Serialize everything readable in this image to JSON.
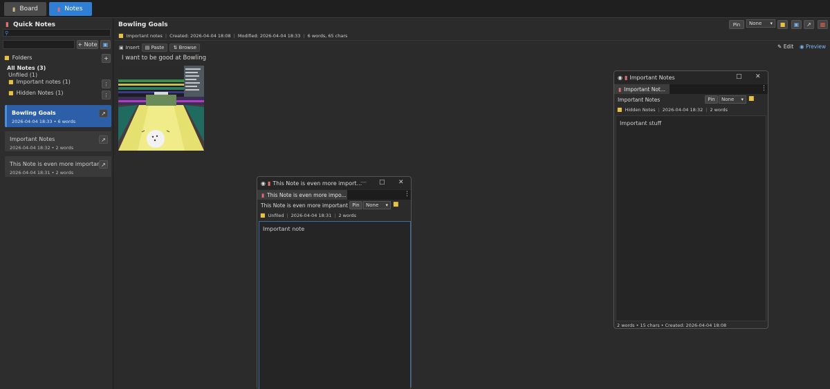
{
  "top_tabs": [
    {
      "label": "Board",
      "icon": "board-icon"
    },
    {
      "label": "Notes",
      "icon": "note-icon",
      "active": true
    }
  ],
  "sidebar": {
    "title": "Quick Notes",
    "search_placeholder": "",
    "new_note_label": "+ Note",
    "folders_label": "Folders",
    "folder_add_label": "+",
    "tree": {
      "all_notes": "All Notes (3)",
      "unfiled": "Unfiled (1)",
      "folders": [
        {
          "label": "Important notes (1)"
        },
        {
          "label": "Hidden Notes (1)"
        }
      ]
    },
    "notes": [
      {
        "title": "Bowling Goals",
        "meta": "2026-04-04 18:33  •  6 words",
        "active": true
      },
      {
        "title": "Important Notes",
        "meta": "2026-04-04 18:32  •  2 words"
      },
      {
        "title": "This Note is even more important",
        "meta": "2026-04-04 18:31  •  2 words"
      }
    ]
  },
  "main": {
    "title": "Bowling Goals",
    "folder": "Important notes",
    "created": "Created: 2026-04-04 18:08",
    "modified": "Modified: 2026-04-04 18:33",
    "stats": "6 words, 65 chars",
    "pin_label": "Pin",
    "color_select": "None",
    "insert_label": "Insert",
    "paste_label": "Paste",
    "browse_label": "Browse",
    "edit_label": "Edit",
    "preview_label": "Preview",
    "body_text": "I want to be good at Bowling"
  },
  "window_important": {
    "title": "Important Notes",
    "tab_label": "Important Not...",
    "title_input": "Important Notes",
    "pin_label": "Pin",
    "color_select": "None",
    "folder": "Hidden Notes",
    "date": "2026-04-04 18:32",
    "words": "2 words",
    "body_text": "Important stuff",
    "status": "2 words  •  15 chars  •  Created: 2026-04-04 18:08"
  },
  "window_even_more": {
    "title": "This Note is even more import...",
    "tab_label": "This Note is even more impo...",
    "title_input": "This Note is even more important",
    "pin_label": "Pin",
    "color_select": "None",
    "folder": "Unfiled",
    "date": "2026-04-04 18:31",
    "words": "2 words",
    "body_text": "Important note"
  },
  "colors": {
    "accent": "#2f7fd6",
    "active_card": "#2c5fa8",
    "folder": "#e8c240",
    "delete": "#c0392b"
  }
}
